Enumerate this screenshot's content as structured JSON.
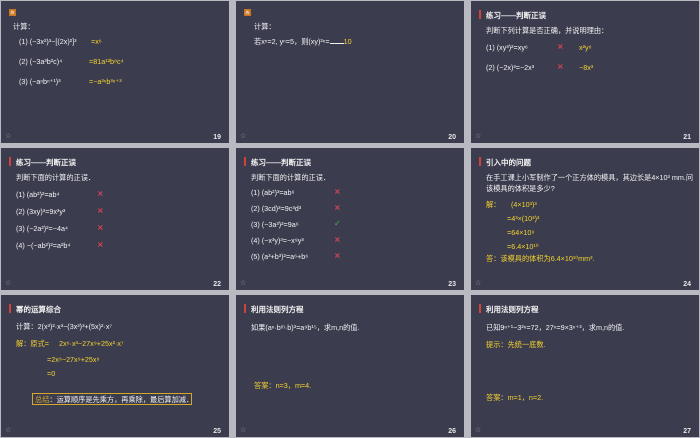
{
  "slides": [
    {
      "number": "19",
      "badge": "练",
      "heading": "计算：",
      "rows": [
        {
          "q": "(1) (−3x²)³−[(2x)²]³",
          "a": "=x⁶"
        },
        {
          "q": "(2) (−3a³b²c)⁴",
          "a": "=81a¹²b⁸c⁴"
        },
        {
          "q": "(3) (−aⁿbⁿ⁺¹)³",
          "a": "=−a³ⁿb³ⁿ⁺³"
        }
      ]
    },
    {
      "number": "20",
      "badge": "练",
      "heading": "计算：",
      "question": "若xⁿ=2, yⁿ=5，则(xy)²ⁿ=",
      "answer": "10"
    },
    {
      "number": "21",
      "title": "练习——判断正误",
      "subtitle": "判断下列计算是否正确，并说明理由：",
      "rows": [
        {
          "q": "(1) (xy³)²=xy⁶",
          "mark": "×",
          "fix": "x²y⁶"
        },
        {
          "q": "(2) (−2x)³=−2x³",
          "mark": "×",
          "fix": "−8x³"
        }
      ]
    },
    {
      "number": "22",
      "title": "练习——判断正误",
      "subtitle": "判断下面的计算的正误．",
      "rows": [
        {
          "q": "(1) (ab²)²=ab⁴",
          "mark": "×"
        },
        {
          "q": "(2) (3xy)³=9x³y³",
          "mark": "×"
        },
        {
          "q": "(3) (−2a²)²=−4a⁴",
          "mark": "×"
        },
        {
          "q": "(4) −(−ab²)²=a²b⁴",
          "mark": "×"
        }
      ]
    },
    {
      "number": "23",
      "title": "练习——判断正误",
      "subtitle": "判断下面的计算的正误．",
      "rows": [
        {
          "q": "(1) (ab²)³=ab⁶",
          "mark": "×"
        },
        {
          "q": "(2) (3cd)³=9c³d³",
          "mark": "×"
        },
        {
          "q": "(3) (−3a³)²=9a⁶",
          "mark": "✓"
        },
        {
          "q": "(4) (−x³y)³=−x⁹y³",
          "mark": "×"
        },
        {
          "q": "(5) (a³+b³)²=a⁶+b⁶",
          "mark": "×"
        }
      ]
    },
    {
      "number": "24",
      "title": "引入中的问题",
      "line1": "在手工课上小军制作了一个正方体的模具，其边长是4×10³ mm.问",
      "line2": "该模具的体积是多少?",
      "solve": "解：",
      "steps": [
        "(4×10³)³",
        "=4³×(10³)³",
        "=64×10⁹",
        "=6.4×10¹⁰"
      ],
      "answer": "答：该模具的体积为6.4×10¹⁰mm³."
    },
    {
      "number": "25",
      "title": "幂的运算综合",
      "calc": "计算：2(x³)²·x³−(3x³)³+(5x)²·x⁷",
      "sol_label": "解：原式=",
      "sol1": "2x⁶·x³−27x⁹+25x²·x⁷",
      "sol2": "=2x⁹−27x⁹+25x⁹",
      "sol3": "=0",
      "summary_label": "总结",
      "summary_text": "：运算顺序是先乘方，再乘除，最后算加减．"
    },
    {
      "number": "26",
      "title": "利用法则列方程",
      "question": "如果(aⁿ·bᵐ·b)³=a⁹b¹⁵，求m,n的值.",
      "answer": "答案：n=3，m=4."
    },
    {
      "number": "27",
      "title": "利用法则列方程",
      "question": "已知9ⁿ⁺¹−3²ⁿ=72，27ⁿ=9×3ⁿ⁺³，求m,n的值.",
      "hint": "提示：先统一底数.",
      "answer": "答案：m=1，n=2."
    }
  ],
  "colors": {
    "slide_bg": "#3b3c4e",
    "page_bg": "#b9b9c1",
    "accent_yellow": "#f5d330",
    "accent_red": "#d4403a",
    "mark_green": "#3cc03c"
  }
}
